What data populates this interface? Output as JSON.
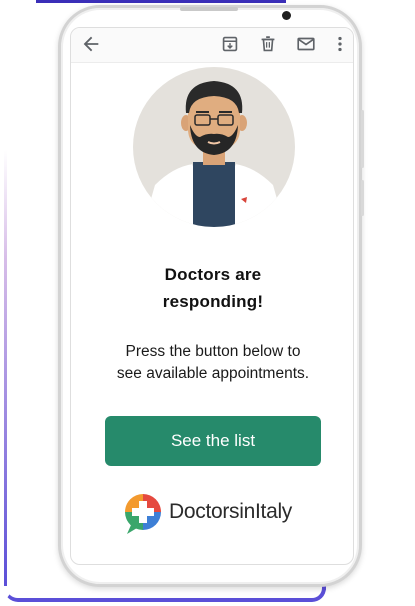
{
  "toolbar": {
    "icons": [
      "back-arrow-icon",
      "archive-icon",
      "delete-icon",
      "mail-icon",
      "more-vert-icon"
    ]
  },
  "email": {
    "headline_line1": "Doctors are",
    "headline_line2": "responding!",
    "body_line1": "Press the button below to",
    "body_line2": "see available appointments.",
    "cta_label": "See the list"
  },
  "brand": {
    "logo_text": "DoctorsinItaly",
    "colors": {
      "cta": "#268a6b",
      "logo_orange": "#f39a2e",
      "logo_red": "#e5493f",
      "logo_green": "#3aa66b",
      "logo_blue": "#3d7fd6",
      "frame_accent": "#5b4fd8"
    }
  }
}
